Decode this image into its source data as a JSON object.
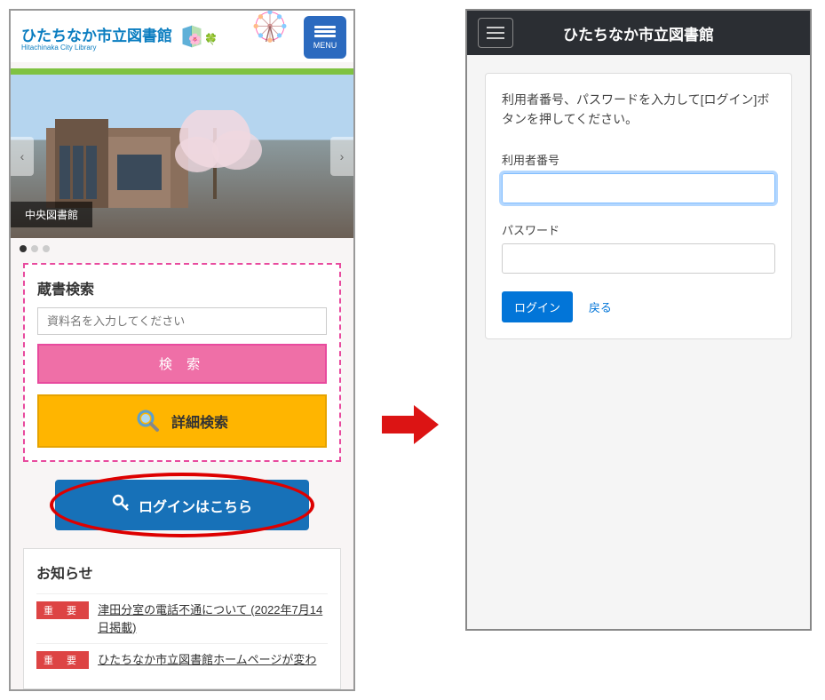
{
  "left": {
    "header": {
      "title": "ひたちなか市立図書館",
      "subtitle": "Hitachinaka City Library",
      "menu_label": "MENU"
    },
    "hero": {
      "caption": "中央図書館"
    },
    "search": {
      "title": "蔵書検索",
      "placeholder": "資料名を入力してください",
      "search_btn": "検 索",
      "detail_btn": "詳細検索"
    },
    "login": {
      "label": "ログインはこちら"
    },
    "news": {
      "title": "お知らせ",
      "tag": "重 要",
      "items": [
        "津田分室の電話不通について (2022年7月14日掲載)",
        "ひたちなか市立図書館ホームページが変わ"
      ]
    }
  },
  "right": {
    "header": {
      "title": "ひたちなか市立図書館"
    },
    "form": {
      "instruction": "利用者番号、パスワードを入力して[ログイン]ボタンを押してください。",
      "user_label": "利用者番号",
      "pass_label": "パスワード",
      "login_btn": "ログイン",
      "back_link": "戻る"
    }
  }
}
